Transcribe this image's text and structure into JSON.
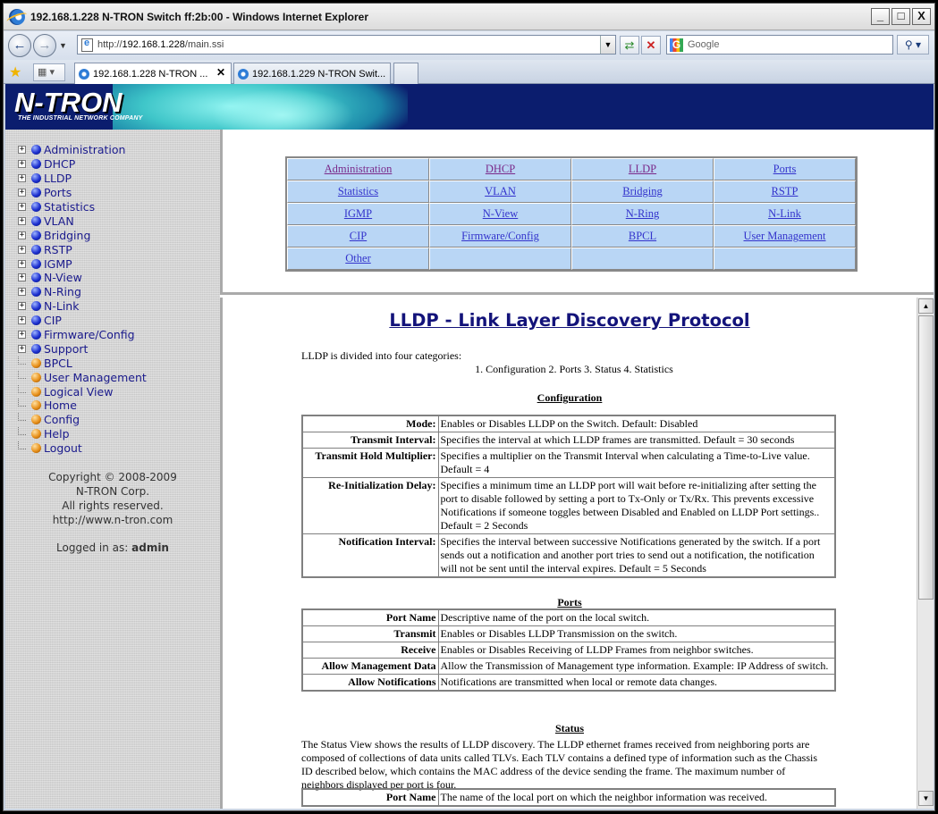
{
  "window": {
    "title": "192.168.1.228 N-TRON Switch ff:2b:00 - Windows Internet Explorer",
    "minimize": "_",
    "maximize": "□",
    "close": "X"
  },
  "browser": {
    "address_prefix": "http://",
    "address_host": "192.168.1.228",
    "address_path": "/main.ssi",
    "search_placeholder": "Google",
    "tabs": [
      {
        "label": "192.168.1.228 N-TRON ...",
        "active": true
      },
      {
        "label": "192.168.1.229 N-TRON Swit...",
        "active": false
      }
    ]
  },
  "banner": {
    "logo": "N-TRON",
    "tagline": "THE INDUSTRIAL NETWORK COMPANY"
  },
  "sidebar": {
    "items": [
      {
        "label": "Administration",
        "expandable": true,
        "color": "blue"
      },
      {
        "label": "DHCP",
        "expandable": true,
        "color": "blue"
      },
      {
        "label": "LLDP",
        "expandable": true,
        "color": "blue"
      },
      {
        "label": "Ports",
        "expandable": true,
        "color": "blue"
      },
      {
        "label": "Statistics",
        "expandable": true,
        "color": "blue"
      },
      {
        "label": "VLAN",
        "expandable": true,
        "color": "blue"
      },
      {
        "label": "Bridging",
        "expandable": true,
        "color": "blue"
      },
      {
        "label": "RSTP",
        "expandable": true,
        "color": "blue"
      },
      {
        "label": "IGMP",
        "expandable": true,
        "color": "blue"
      },
      {
        "label": "N-View",
        "expandable": true,
        "color": "blue"
      },
      {
        "label": "N-Ring",
        "expandable": true,
        "color": "blue"
      },
      {
        "label": "N-Link",
        "expandable": true,
        "color": "blue"
      },
      {
        "label": "CIP",
        "expandable": true,
        "color": "blue"
      },
      {
        "label": "Firmware/Config",
        "expandable": true,
        "color": "blue"
      },
      {
        "label": "Support",
        "expandable": true,
        "color": "blue"
      },
      {
        "label": "BPCL",
        "expandable": false,
        "color": "orange"
      },
      {
        "label": "User Management",
        "expandable": false,
        "color": "orange"
      },
      {
        "label": "Logical View",
        "expandable": false,
        "color": "orange"
      },
      {
        "label": "Home",
        "expandable": false,
        "color": "orange"
      },
      {
        "label": "Config",
        "expandable": false,
        "color": "orange"
      },
      {
        "label": "Help",
        "expandable": false,
        "color": "orange"
      },
      {
        "label": "Logout",
        "expandable": false,
        "color": "orange"
      }
    ],
    "copyright_lines": [
      "Copyright © 2008-2009",
      "N-TRON Corp.",
      "All rights reserved.",
      "http://www.n-tron.com"
    ],
    "logged_in_label": "Logged in as:",
    "logged_in_user": "admin"
  },
  "nav_grid": [
    {
      "label": "Administration",
      "visited": true
    },
    {
      "label": "DHCP",
      "visited": true
    },
    {
      "label": "LLDP",
      "visited": true
    },
    {
      "label": "Ports",
      "visited": false
    },
    {
      "label": "Statistics",
      "visited": false
    },
    {
      "label": "VLAN",
      "visited": false
    },
    {
      "label": "Bridging",
      "visited": false
    },
    {
      "label": "RSTP",
      "visited": false
    },
    {
      "label": "IGMP",
      "visited": false
    },
    {
      "label": "N-View",
      "visited": false
    },
    {
      "label": "N-Ring",
      "visited": false
    },
    {
      "label": "N-Link",
      "visited": false
    },
    {
      "label": "CIP",
      "visited": false
    },
    {
      "label": "Firmware/Config",
      "visited": false
    },
    {
      "label": "BPCL",
      "visited": false
    },
    {
      "label": "User Management",
      "visited": false
    },
    {
      "label": "Other",
      "visited": false
    },
    {
      "label": "",
      "visited": false
    },
    {
      "label": "",
      "visited": false
    },
    {
      "label": "",
      "visited": false
    }
  ],
  "content": {
    "title": "LLDP - Link Layer Discovery Protocol",
    "intro": "LLDP is divided into four categories:",
    "categories": "1. Configuration  2. Ports  3. Status  4. Statistics",
    "configuration": {
      "heading": "Configuration",
      "rows": [
        {
          "key": "Mode:",
          "value": "Enables or Disables LLDP on the Switch. Default: Disabled"
        },
        {
          "key": "Transmit Interval:",
          "value": "Specifies the interval at which LLDP frames are transmitted. Default = 30 seconds"
        },
        {
          "key": "Transmit Hold Multiplier:",
          "value": "Specifies a multiplier on the Transmit Interval when calculating a Time-to-Live value. Default = 4"
        },
        {
          "key": "Re-Initialization Delay:",
          "value": "Specifies a minimum time an LLDP port will wait before re-initializing after setting the port to disable followed by setting a port to Tx-Only or Tx/Rx. This prevents excessive Notifications if someone toggles between Disabled and Enabled on LLDP Port settings.. Default = 2 Seconds"
        },
        {
          "key": "Notification Interval:",
          "value": "Specifies the interval between successive Notifications generated by the switch. If a port sends out a notification and another port tries to send out a notification, the notification will not be sent until the interval expires. Default = 5 Seconds"
        }
      ]
    },
    "ports": {
      "heading": "Ports",
      "rows": [
        {
          "key": "Port Name",
          "value": "Descriptive name of the port on the local switch."
        },
        {
          "key": "Transmit",
          "value": "Enables or Disables LLDP Transmission on the switch."
        },
        {
          "key": "Receive",
          "value": "Enables or Disables Receiving of LLDP Frames from neighbor switches."
        },
        {
          "key": "Allow Management Data",
          "value": "Allow the Transmission of Management type information. Example: IP Address of switch."
        },
        {
          "key": "Allow Notifications",
          "value": "Notifications are transmitted when local or remote data changes."
        }
      ]
    },
    "status": {
      "heading": "Status",
      "text": "The Status View shows the results of LLDP discovery. The LLDP ethernet frames received from neighboring ports are composed of collections of data units called TLVs. Each TLV contains a defined type of information such as the Chassis ID described below, which contains the MAC address of the device sending the frame. The maximum number of neighbors displayed per port is four.",
      "rows": [
        {
          "key": "Port Name",
          "value": "The name of the local port on which the neighbor information was received."
        }
      ]
    }
  }
}
